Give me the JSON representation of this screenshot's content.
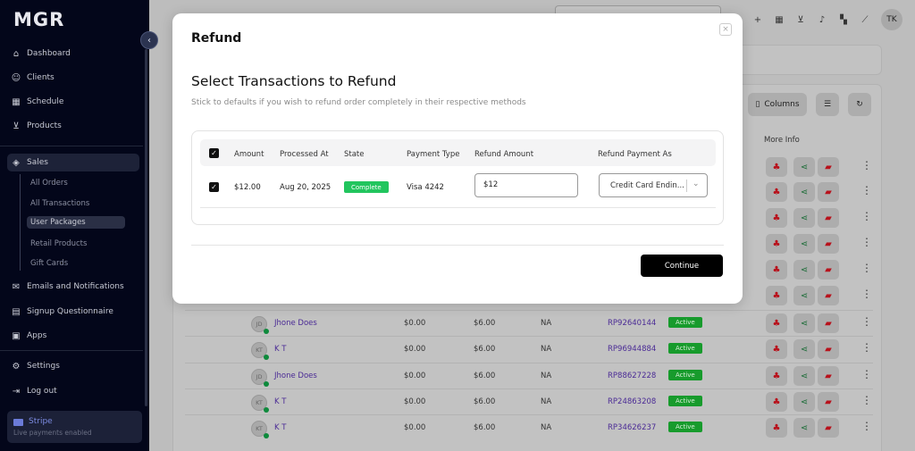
{
  "app": {
    "logo": "MGR",
    "user_initials": "TK"
  },
  "sidebar": {
    "items": [
      {
        "label": "Dashboard",
        "icon": "home-icon"
      },
      {
        "label": "Clients",
        "icon": "user-icon"
      },
      {
        "label": "Schedule",
        "icon": "calendar-icon"
      },
      {
        "label": "Products",
        "icon": "cart-icon"
      },
      {
        "label": "Sales",
        "icon": "tag-icon"
      },
      {
        "label": "Emails and Notifications",
        "icon": "mail-icon"
      },
      {
        "label": "Signup Questionnaire",
        "icon": "form-icon"
      },
      {
        "label": "Apps",
        "icon": "apps-icon"
      },
      {
        "label": "Settings",
        "icon": "gear-icon"
      },
      {
        "label": "Log out",
        "icon": "logout-icon"
      }
    ],
    "sales_subitems": [
      "All Orders",
      "All Transactions",
      "User Packages",
      "Retail Products",
      "Gift Cards"
    ],
    "active_subitem": "User Packages",
    "stripe": {
      "name": "Stripe",
      "status": "Live payments enabled"
    }
  },
  "background": {
    "columns_button": "Columns",
    "more_info_header": "More Info",
    "rows": [
      {
        "initials": "JD",
        "name": "Jhone Does",
        "v1": "$0.00",
        "v2": "$6.00",
        "na": "NA",
        "rp": "RP92640144",
        "status": "Active"
      },
      {
        "initials": "KT",
        "name": "K T",
        "v1": "$0.00",
        "v2": "$6.00",
        "na": "NA",
        "rp": "RP96944884",
        "status": "Active"
      },
      {
        "initials": "JD",
        "name": "Jhone Does",
        "v1": "$0.00",
        "v2": "$6.00",
        "na": "NA",
        "rp": "RP88627228",
        "status": "Active"
      },
      {
        "initials": "KT",
        "name": "K T",
        "v1": "$0.00",
        "v2": "$6.00",
        "na": "NA",
        "rp": "RP24863208",
        "status": "Active"
      },
      {
        "initials": "KT",
        "name": "K T",
        "v1": "$0.00",
        "v2": "$6.00",
        "na": "NA",
        "rp": "RP34626237",
        "status": "Active"
      }
    ]
  },
  "modal": {
    "title": "Refund",
    "close_symbol": "×",
    "section_title": "Select Transactions to Refund",
    "section_subtitle": "Stick to defaults if you wish to refund order completely in their respective methods",
    "headers": [
      "Amount",
      "Processed At",
      "State",
      "Payment Type",
      "Refund Amount",
      "Refund Payment As"
    ],
    "row": {
      "amount": "$12.00",
      "processed_at": "Aug 20, 2025",
      "state": "Complete",
      "payment_type": "Visa 4242",
      "refund_amount": "$12",
      "refund_payment_as": "Credit Card Endin..."
    },
    "continue_label": "Continue"
  },
  "colors": {
    "status_complete": "#22c55e",
    "status_active": "#179b2c",
    "sidebar_bg": "#03061a",
    "primary_button": "#000000"
  }
}
